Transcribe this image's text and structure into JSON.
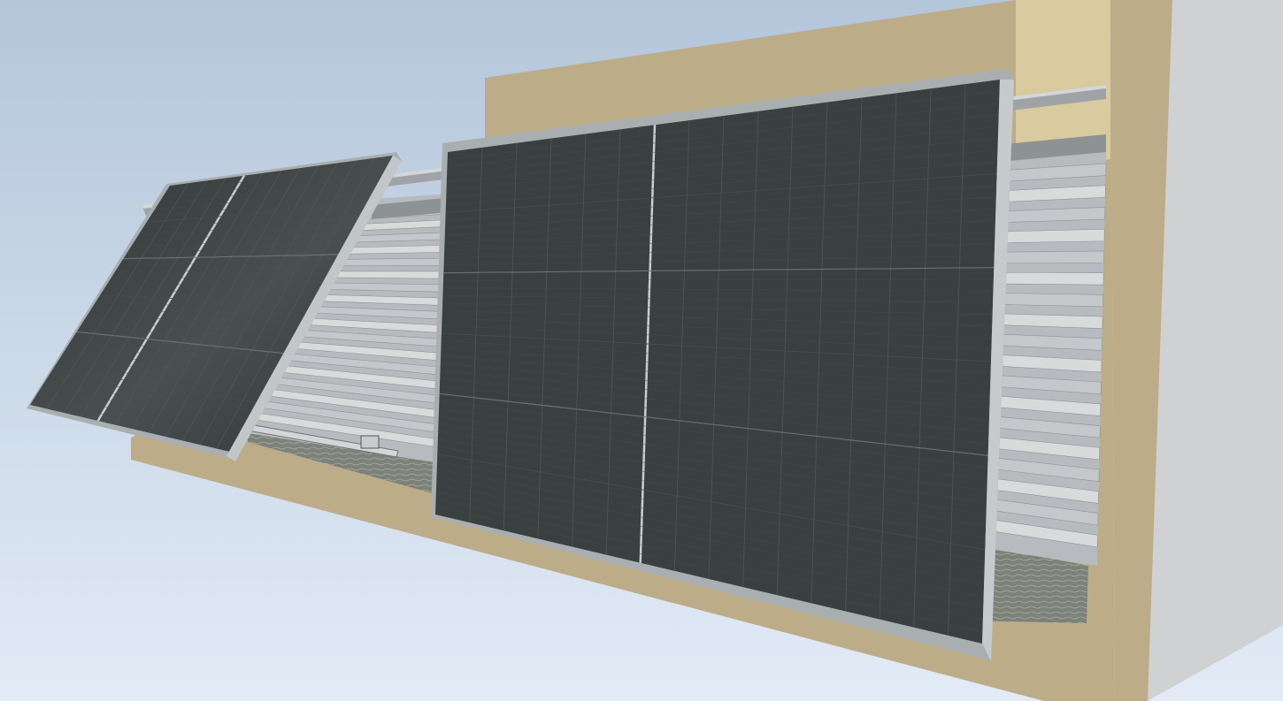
{
  "scene": {
    "colors": {
      "background_top": "#b4c6da",
      "background_bottom": "#e2ebf6",
      "wall": "#bcad88",
      "wall_light": "#d9ca9f",
      "side_wall": "#d0d1d3",
      "panel_cell": "#3a3f40",
      "panel_frame": "#a9aeb1",
      "railing_slat": "#c9cccf",
      "railing_slat_dark": "#9ea3a7",
      "floor": "#7c817a"
    },
    "objects": [
      "wall",
      "balcony-railing",
      "solar-panel-tilted",
      "solar-panel-flat",
      "mounting-rail"
    ]
  }
}
